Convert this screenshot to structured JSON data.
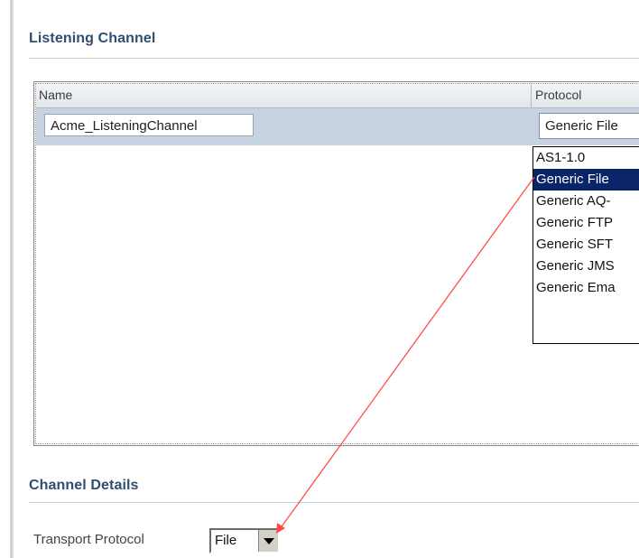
{
  "listening_channel": {
    "title": "Listening Channel",
    "columns": [
      "Name",
      "Protocol"
    ],
    "row": {
      "name": "Acme_ListeningChannel",
      "protocol": "Generic File"
    },
    "protocol_options": [
      "AS1-1.0",
      "Generic File",
      "Generic AQ-",
      "Generic FTP",
      "Generic SFT",
      "Generic JMS",
      "Generic Ema"
    ],
    "selected_option": "Generic File"
  },
  "channel_details": {
    "title": "Channel Details",
    "transport_protocol_label": "Transport Protocol",
    "transport_protocol_value": "File"
  },
  "colors": {
    "heading": "#2f4f72",
    "row_highlight": "#c8d3e2",
    "dropdown_selected": "#0a246a",
    "annotation_arrow": "#ff4d4d"
  },
  "icons": [
    "chevron-down-icon"
  ]
}
